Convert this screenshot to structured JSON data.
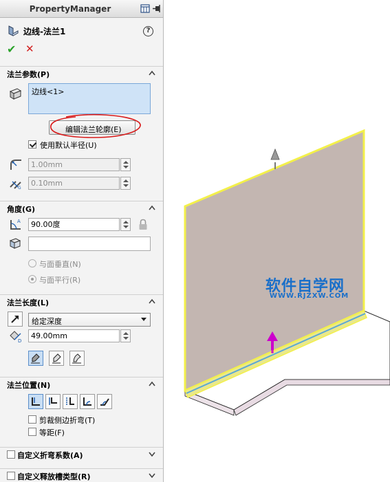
{
  "panel": {
    "title": "PropertyManager",
    "feature_title": "边线-法兰1",
    "help_glyph": "?",
    "ok_glyph": "✔",
    "cancel_glyph": "✕"
  },
  "flange_params": {
    "header": "法兰参数(P)",
    "selection_item": "边线<1>",
    "edit_profile_button": "编辑法兰轮廓(E)",
    "use_default_radius_label": "使用默认半径(U)",
    "use_default_radius_checked": true,
    "radius_value": "1.00mm",
    "gap_value": "0.10mm"
  },
  "angle": {
    "header": "角度(G)",
    "angle_value": "90.00度",
    "face_value": "",
    "option_normal": "与面垂直(N)",
    "option_parallel": "与面平行(R)",
    "selected_option": "parallel"
  },
  "flange_length": {
    "header": "法兰长度(L)",
    "end_condition": "给定深度",
    "length_value": "49.00mm"
  },
  "flange_position": {
    "header": "法兰位置(N)",
    "trim_side_bends_label": "剪裁侧边折弯(T)",
    "offset_label": "等距(F)"
  },
  "collapsed_sections": [
    {
      "label": "自定义折弯系数(A)"
    },
    {
      "label": "自定义释放槽类型(R)"
    }
  ],
  "watermark": {
    "text": "软件自学网",
    "url": "WWW.RJZXW.COM",
    "color": "#1a6fc9"
  },
  "colors": {
    "selection_box": "#cfe3f7",
    "annotation_circle": "#d81b1b",
    "flange_face": "#c3b6b1",
    "highlight_edge": "#f3f04a",
    "arrow": "#cc00cc"
  }
}
